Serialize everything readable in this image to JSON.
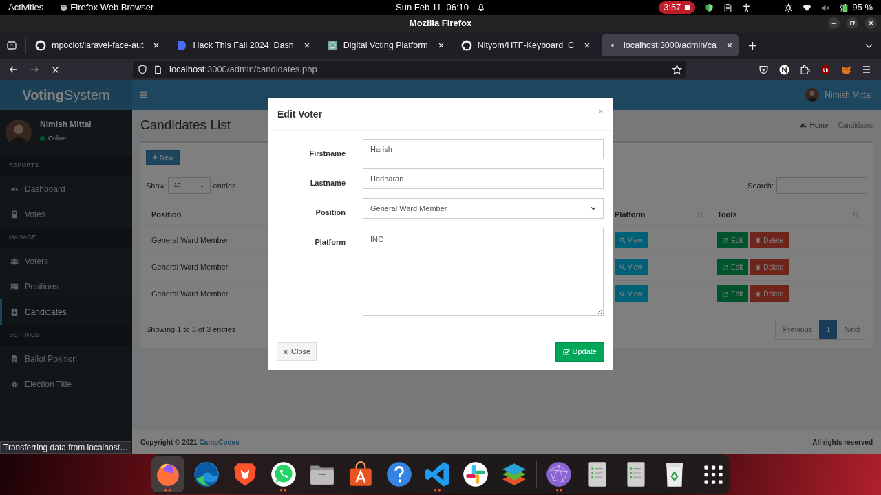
{
  "top_bar": {
    "activities": "Activities",
    "app_name": "Firefox Web Browser",
    "clock": "Sun Feb 11  06:10",
    "recording_time": "3:57",
    "battery": "95 %"
  },
  "window": {
    "title": "Mozilla Firefox"
  },
  "tabs": [
    {
      "label": "mpociot/laravel-face-aut",
      "kind": "github",
      "selected": false
    },
    {
      "label": "Hack This Fall 2024: Dash",
      "kind": "doc",
      "selected": false
    },
    {
      "label": "Digital Voting Platform",
      "kind": "bot",
      "selected": false
    },
    {
      "label": "Nityom/HTF-Keyboard_C",
      "kind": "github",
      "selected": false
    },
    {
      "label": "localhost:3000/admin/ca",
      "kind": "loading",
      "selected": true
    }
  ],
  "url": {
    "host": "localhost",
    "path": ":3000/admin/candidates.php"
  },
  "page": {
    "brand": "**Voting**System",
    "user_name": "Nimish Mittal",
    "user_status": "Online",
    "header_user": "Nimish Mittal",
    "sidebar": [
      {
        "kind": "header",
        "label": "REPORTS"
      },
      {
        "kind": "item",
        "label": "Dashboard",
        "selected": false
      },
      {
        "kind": "item",
        "label": "Votes",
        "selected": false
      },
      {
        "kind": "header",
        "label": "MANAGE"
      },
      {
        "kind": "item",
        "label": "Voters",
        "selected": false
      },
      {
        "kind": "item",
        "label": "Positions",
        "selected": false
      },
      {
        "kind": "item",
        "label": "Candidates",
        "selected": true
      },
      {
        "kind": "header",
        "label": "SETTINGS"
      },
      {
        "kind": "item",
        "label": "Ballot Position",
        "selected": false
      },
      {
        "kind": "item",
        "label": "Election Title",
        "selected": false
      }
    ],
    "heading": "Candidates List",
    "breadcrumb": [
      "Home",
      "Candidates"
    ],
    "new_button": "New",
    "show_label": "Show",
    "entries_value": "10",
    "entries_label": "entries",
    "search_label": "Search:",
    "columns": [
      "Position",
      "Platform",
      "Tools"
    ],
    "rows": [
      {
        "position": "General Ward Member",
        "view": "View",
        "edit": "Edit",
        "delete": "Delete"
      },
      {
        "position": "General Ward Member",
        "view": "View",
        "edit": "Edit",
        "delete": "Delete"
      },
      {
        "position": "General Ward Member",
        "view": "View",
        "edit": "Edit",
        "delete": "Delete"
      }
    ],
    "info": "Showing 1 to 3 of 3 entries",
    "pagination": [
      {
        "label": "Previous",
        "selected": false
      },
      {
        "label": "1",
        "selected": true
      },
      {
        "label": "Next",
        "selected": false
      }
    ],
    "footer_left": "Copyright © 2021",
    "footer_link": "CampCodes",
    "footer_right": "All rights reserved"
  },
  "modal": {
    "title": "Edit Voter",
    "fields": [
      {
        "label": "Firstname",
        "kind": "text",
        "value": "Harish"
      },
      {
        "label": "Lastname",
        "kind": "text",
        "value": "Hariharan"
      },
      {
        "label": "Position",
        "kind": "select",
        "value": "General Ward Member"
      },
      {
        "label": "Platform",
        "kind": "textarea",
        "value": "INC"
      }
    ],
    "close_button": "Close",
    "update_button": "Update"
  },
  "status_text": "Transferring data from localhost…",
  "dock": [
    {
      "kind": "firefox",
      "running": true,
      "selected": true
    },
    {
      "kind": "edge",
      "running": false,
      "selected": false
    },
    {
      "kind": "brave",
      "running": false,
      "selected": false
    },
    {
      "kind": "whatsapp",
      "running": true,
      "selected": false
    },
    {
      "kind": "files",
      "running": false,
      "selected": false
    },
    {
      "kind": "store",
      "running": false,
      "selected": false
    },
    {
      "kind": "help",
      "running": false,
      "selected": false
    },
    {
      "kind": "vscode",
      "running": true,
      "selected": false
    },
    {
      "kind": "slack",
      "running": false,
      "selected": false
    },
    {
      "kind": "layers",
      "running": false,
      "selected": false
    },
    {
      "kind": "globe",
      "running": true,
      "selected": false
    },
    {
      "kind": "doc",
      "running": false,
      "selected": false
    },
    {
      "kind": "doc",
      "running": false,
      "selected": false
    },
    {
      "kind": "trash",
      "running": false,
      "selected": false
    },
    {
      "kind": "grid",
      "running": false,
      "selected": false
    }
  ]
}
